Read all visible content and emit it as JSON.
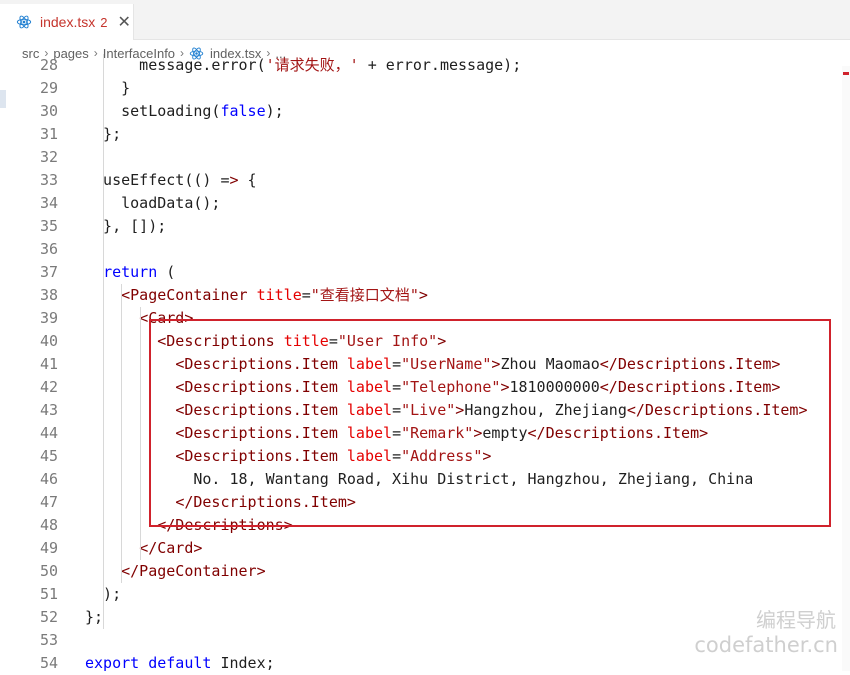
{
  "tab": {
    "filename": "index.tsx",
    "problems": "2",
    "close": "✕"
  },
  "breadcrumb": {
    "items": [
      "src",
      "pages",
      "InterfaceInfo",
      "index.tsx",
      "..."
    ]
  },
  "editor": {
    "lines": [
      {
        "n": "28",
        "text": "      message.error('请求失败，' + error.message);"
      },
      {
        "n": "29",
        "text": "    }"
      },
      {
        "n": "30",
        "text": "    setLoading(false);"
      },
      {
        "n": "31",
        "text": "  };"
      },
      {
        "n": "32",
        "text": ""
      },
      {
        "n": "33",
        "text": "  useEffect(() => {"
      },
      {
        "n": "34",
        "text": "    loadData();"
      },
      {
        "n": "35",
        "text": "  }, []);"
      },
      {
        "n": "36",
        "text": ""
      },
      {
        "n": "37",
        "text": "  return ("
      },
      {
        "n": "38",
        "text": "    <PageContainer title=\"查看接口文档\">"
      },
      {
        "n": "39",
        "text": "      <Card>"
      },
      {
        "n": "40",
        "text": "        <Descriptions title=\"User Info\">"
      },
      {
        "n": "41",
        "text": "          <Descriptions.Item label=\"UserName\">Zhou Maomao</Descriptions.Item>"
      },
      {
        "n": "42",
        "text": "          <Descriptions.Item label=\"Telephone\">1810000000</Descriptions.Item>"
      },
      {
        "n": "43",
        "text": "          <Descriptions.Item label=\"Live\">Hangzhou, Zhejiang</Descriptions.Item>"
      },
      {
        "n": "44",
        "text": "          <Descriptions.Item label=\"Remark\">empty</Descriptions.Item>"
      },
      {
        "n": "45",
        "text": "          <Descriptions.Item label=\"Address\">"
      },
      {
        "n": "46",
        "text": "            No. 18, Wantang Road, Xihu District, Hangzhou, Zhejiang, China"
      },
      {
        "n": "47",
        "text": "          </Descriptions.Item>"
      },
      {
        "n": "48",
        "text": "        </Descriptions>"
      },
      {
        "n": "49",
        "text": "      </Card>"
      },
      {
        "n": "50",
        "text": "    </PageContainer>"
      },
      {
        "n": "51",
        "text": "  );"
      },
      {
        "n": "52",
        "text": "};"
      },
      {
        "n": "53",
        "text": ""
      },
      {
        "n": "54",
        "text": "export default Index;"
      }
    ]
  },
  "watermark": {
    "line1": "编程导航",
    "line2": "codefather.cn"
  },
  "colors": {
    "keyword": "#0000ff",
    "tag": "#800000",
    "attribute": "#e50000",
    "string": "#a31515",
    "highlight": "#d0222c"
  }
}
